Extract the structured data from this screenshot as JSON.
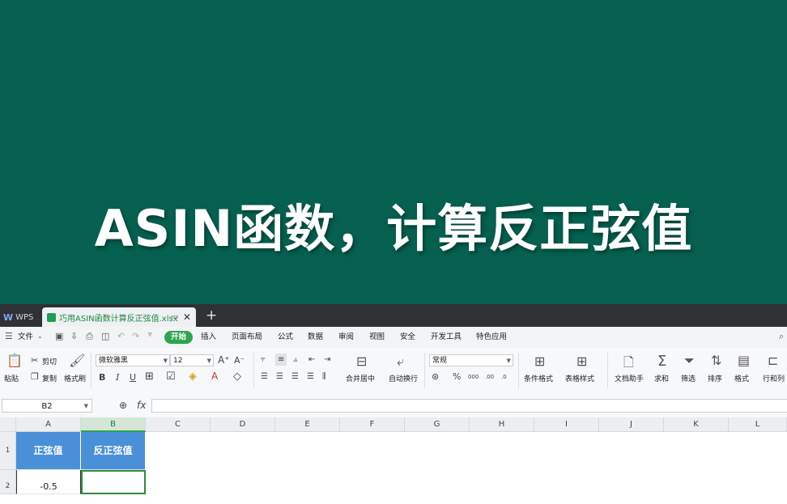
{
  "banner": {
    "title": "ASIN函数，计算反正弦值",
    "bg_color": "#05604f"
  },
  "tabbar": {
    "app_tab": "WPS",
    "doc_tab": "巧用ASIN函数计算反正弦值.xlsx",
    "new_tab_icon": "plus-icon"
  },
  "menubar": {
    "file_menu": "文件",
    "tabs": [
      "开始",
      "插入",
      "页面布局",
      "公式",
      "数据",
      "审阅",
      "视图",
      "安全",
      "开发工具",
      "特色应用"
    ],
    "active_tab": "开始",
    "accent_color": "#2ea44f"
  },
  "ribbon": {
    "paste": "粘贴",
    "cut": "剪切",
    "copy": "复制",
    "format_painter": "格式刷",
    "font_name": "微软雅黑",
    "font_size": "12",
    "merge_center": "合并居中",
    "auto_wrap": "自动换行",
    "number_format": "常规",
    "conditional_format": "条件格式",
    "table_style": "表格样式",
    "doc_helper": "文档助手",
    "sum": "求和",
    "filter": "筛选",
    "sort": "排序",
    "format": "格式",
    "row_col": "行和列"
  },
  "formula_bar": {
    "cell_ref": "B2",
    "fx_label": "fx",
    "value": ""
  },
  "grid": {
    "columns": [
      "A",
      "B",
      "C",
      "D",
      "E",
      "F",
      "G",
      "H",
      "I",
      "J",
      "K",
      "L"
    ],
    "selected_column": "B",
    "rows": [
      "1",
      "2"
    ],
    "header_row": [
      "正弦值",
      "反正弦值"
    ],
    "row2": [
      "-0.5",
      ""
    ],
    "header_color": "#4a90d9"
  }
}
